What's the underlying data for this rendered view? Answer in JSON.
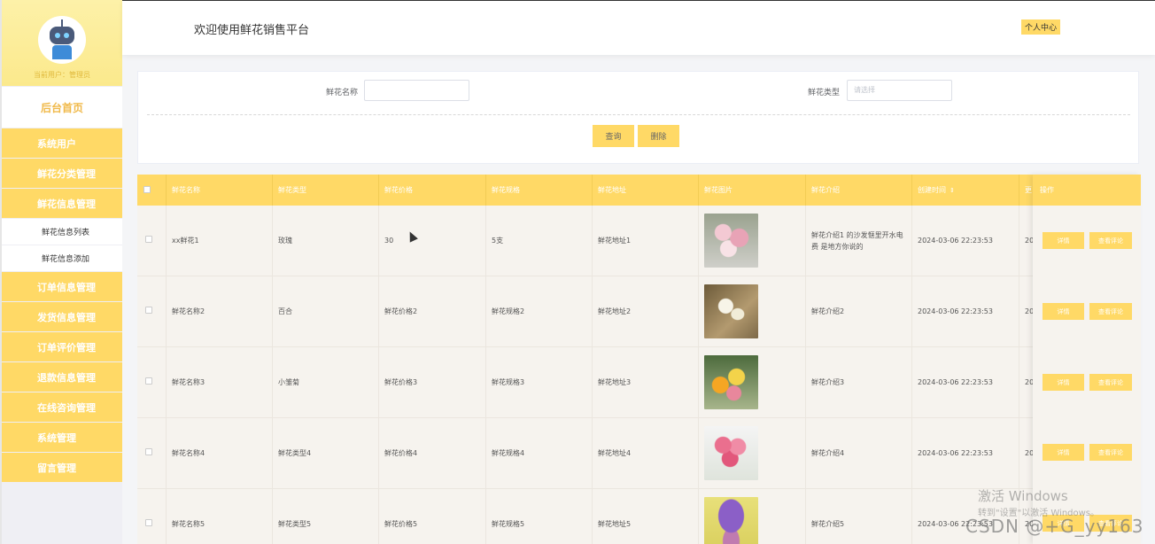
{
  "sidebar": {
    "user_label": "当前用户：管理员",
    "home": "后台首页",
    "items": [
      "系统用户",
      "鲜花分类管理",
      "鲜花信息管理"
    ],
    "subitems": [
      "鲜花信息列表",
      "鲜花信息添加"
    ],
    "items2": [
      "订单信息管理",
      "发货信息管理",
      "订单评价管理",
      "退款信息管理",
      "在线咨询管理",
      "系统管理",
      "留言管理"
    ]
  },
  "header": {
    "title": "欢迎使用鲜花销售平台",
    "profile_button": "个人中心"
  },
  "search": {
    "name_label": "鲜花名称",
    "name_value": "",
    "type_label": "鲜花类型",
    "type_placeholder": "请选择",
    "query_button": "查询",
    "delete_button": "删除"
  },
  "table": {
    "columns": [
      "鲜花名称",
      "鲜花类型",
      "鲜花价格",
      "鲜花规格",
      "鲜花地址",
      "鲜花图片",
      "鲜花介绍",
      "创建时间",
      "更",
      "操作"
    ],
    "rows": [
      {
        "name": "xx鲜花1",
        "type": "玫瑰",
        "price": "30",
        "spec": "5支",
        "address": "鲜花地址1",
        "intro": "鲜花介绍1 的沙发惬里开水电费 是地方你说的",
        "created": "2024-03-06 22:23:53",
        "updated": "20"
      },
      {
        "name": "鲜花名称2",
        "type": "百合",
        "price": "鲜花价格2",
        "spec": "鲜花规格2",
        "address": "鲜花地址2",
        "intro": "鲜花介绍2",
        "created": "2024-03-06 22:23:53",
        "updated": "20"
      },
      {
        "name": "鲜花名称3",
        "type": "小雏菊",
        "price": "鲜花价格3",
        "spec": "鲜花规格3",
        "address": "鲜花地址3",
        "intro": "鲜花介绍3",
        "created": "2024-03-06 22:23:53",
        "updated": "20"
      },
      {
        "name": "鲜花名称4",
        "type": "鲜花类型4",
        "price": "鲜花价格4",
        "spec": "鲜花规格4",
        "address": "鲜花地址4",
        "intro": "鲜花介绍4",
        "created": "2024-03-06 22:23:53",
        "updated": "20"
      },
      {
        "name": "鲜花名称5",
        "type": "鲜花类型5",
        "price": "鲜花价格5",
        "spec": "鲜花规格5",
        "address": "鲜花地址5",
        "intro": "鲜花介绍5",
        "created": "2024-03-06 22:23:53",
        "updated": "20"
      }
    ],
    "detail_button": "详情",
    "review_button": "查看评论"
  },
  "watermark": {
    "line1": "激活 Windows",
    "line2": "转到\"设置\"以激活 Windows。",
    "line3": "CSDN @+G_yy163"
  },
  "colors": {
    "accent": "#ffd966",
    "sidebar_bg": "#efeff4",
    "table_bg": "#f6f3ee"
  }
}
